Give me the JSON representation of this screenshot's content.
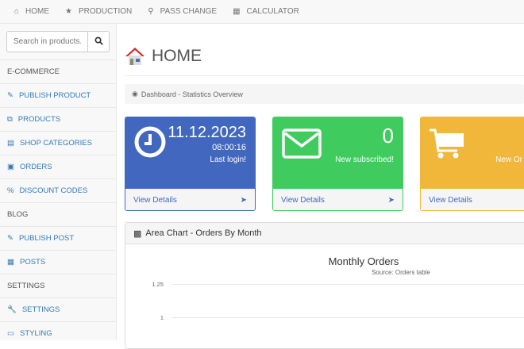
{
  "topnav": [
    {
      "label": "HOME",
      "icon": "home-icon"
    },
    {
      "label": "PRODUCTION",
      "icon": "star-icon"
    },
    {
      "label": "PASS CHANGE",
      "icon": "key-icon"
    },
    {
      "label": "CALCULATOR",
      "icon": "calculator-icon"
    }
  ],
  "search": {
    "placeholder": "Search in products."
  },
  "sidebar": [
    {
      "label": "E-COMMERCE",
      "head": true
    },
    {
      "label": "PUBLISH PRODUCT",
      "icon": "edit-icon"
    },
    {
      "label": "PRODUCTS",
      "icon": "copy-icon"
    },
    {
      "label": "SHOP CATEGORIES",
      "icon": "list-icon"
    },
    {
      "label": "ORDERS",
      "icon": "money-icon"
    },
    {
      "label": "DISCOUNT CODES",
      "icon": "percent-icon"
    },
    {
      "label": "BLOG",
      "head": true
    },
    {
      "label": "PUBLISH POST",
      "icon": "edit-icon"
    },
    {
      "label": "POSTS",
      "icon": "grid-icon"
    },
    {
      "label": "SETTINGS",
      "head": true
    },
    {
      "label": "SETTINGS",
      "icon": "wrench-icon"
    },
    {
      "label": "STYLING",
      "icon": "laptop-icon"
    }
  ],
  "page_title": "HOME",
  "breadcrumb": "Dashboard - Statistics Overview",
  "cards": [
    {
      "big": "11.12.2023",
      "line2": "08:00:16",
      "line3": "Last login!",
      "link": "View Details",
      "color": "#4267be"
    },
    {
      "big": "0",
      "line3": "New subscribed!",
      "link": "View Details",
      "color": "#3fcb5e"
    },
    {
      "line3": "New Or",
      "link": "View Details",
      "color": "#f0b73a"
    }
  ],
  "panel": {
    "title": "Area Chart - Orders By Month"
  },
  "chart_data": {
    "type": "area",
    "title": "Monthly Orders",
    "subtitle": "Source: Orders table",
    "yticks": [
      "1.25",
      "1"
    ]
  }
}
